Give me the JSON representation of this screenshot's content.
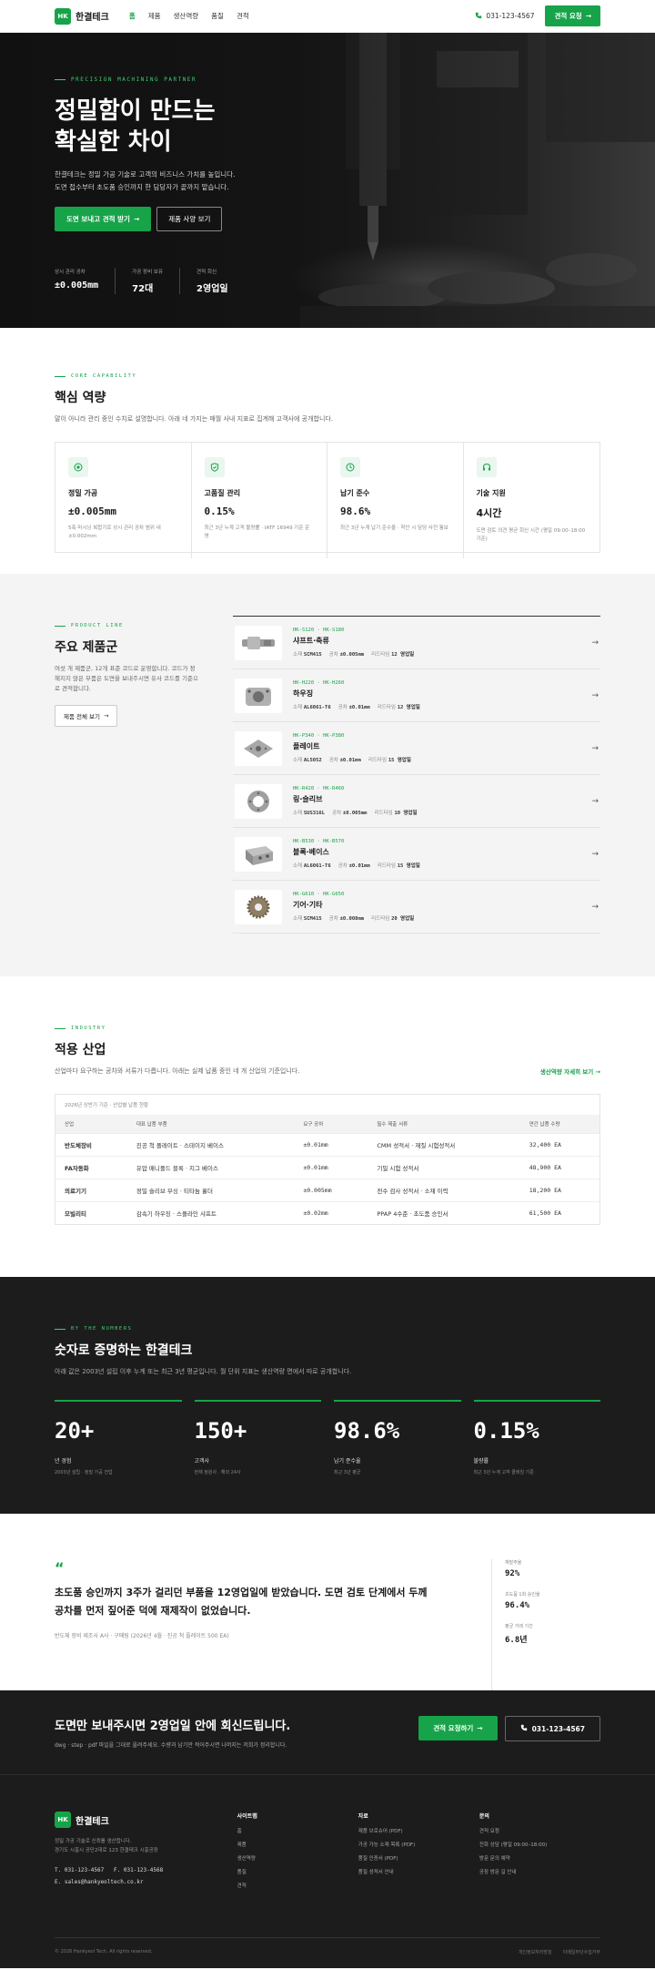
{
  "header": {
    "logo": "HK",
    "brand": "한결테크",
    "nav": [
      "홈",
      "제품",
      "생산역량",
      "품질",
      "견적"
    ],
    "phone": "031-123-4567",
    "cta": "견적 요청"
  },
  "hero": {
    "eyebrow": "PRECISION MACHINING PARTNER",
    "title_line1": "정밀함이 만드는",
    "title_line2": "확실한 차이",
    "desc_line1": "한결테크는 정밀 가공 기술로 고객의 비즈니스 가치를 높입니다.",
    "desc_line2": "도면 접수부터 초도품 승인까지 한 담당자가 끝까지 맡습니다.",
    "btn_primary": "도면 보내고 견적 받기",
    "btn_secondary": "제품 사양 보기",
    "stats": [
      {
        "label": "상시 관리 공차",
        "value": "±0.005mm"
      },
      {
        "label": "가공 장비 보유",
        "value": "72대"
      },
      {
        "label": "견적 회신",
        "value": "2영업일"
      }
    ]
  },
  "capability": {
    "eyebrow": "CORE CAPABILITY",
    "title": "핵심 역량",
    "desc": "말이 아니라 관리 중인 수치로 설명합니다. 아래 네 가지는 매월 사내 지표로 집계해 고객사에 공개합니다.",
    "cards": [
      {
        "icon": "target-icon",
        "name": "정밀 가공",
        "value": "±0.005mm",
        "desc": "5축 머시닝 복합기로 상시 관리 공차 범위 내 ±0.002mm"
      },
      {
        "icon": "shield-check-icon",
        "name": "고품질 관리",
        "value": "0.15%",
        "desc": "최근 3년 누계 고객 불량률 · IATF 16949 기준 운영"
      },
      {
        "icon": "clock-icon",
        "name": "납기 준수",
        "value": "98.6%",
        "desc": "최근 3년 누계 납기 준수율 · 착안 시 담당 사전 통보"
      },
      {
        "icon": "headset-icon",
        "name": "기술 지원",
        "value": "4시간",
        "desc": "도면 검토 의견 평균 회신 시간 (평일 09:00–18:00 기준)"
      }
    ]
  },
  "products": {
    "eyebrow": "PRODUCT LINE",
    "title": "주요 제품군",
    "desc": "여섯 개 제품군, 12개 표준 코드로 운영합니다. 코드가 정해지지 않은 부품은 도면을 보내주시면 유사 코드를 기준으로 견적합니다.",
    "button": "제품 전체 보기",
    "labels": {
      "material": "소재",
      "tolerance": "공차",
      "lead": "리드타임"
    },
    "items": [
      {
        "code": "HK-S120 · HK-S180",
        "name": "샤프트·축류",
        "material": "SCM415",
        "tolerance": "±0.005mm",
        "lead": "12 영업일",
        "shape": "shaft"
      },
      {
        "code": "HK-H220 · HK-H260",
        "name": "하우징",
        "material": "AL6061-T6",
        "tolerance": "±0.01mm",
        "lead": "12 영업일",
        "shape": "housing"
      },
      {
        "code": "HK-P340 · HK-P380",
        "name": "플레이트",
        "material": "AL5052",
        "tolerance": "±0.01mm",
        "lead": "15 영업일",
        "shape": "plate"
      },
      {
        "code": "HK-R420 · HK-R460",
        "name": "링·슬리브",
        "material": "SUS316L",
        "tolerance": "±0.005mm",
        "lead": "10 영업일",
        "shape": "ring"
      },
      {
        "code": "HK-B530 · HK-B570",
        "name": "블록·베이스",
        "material": "AL6061-T6",
        "tolerance": "±0.01mm",
        "lead": "15 영업일",
        "shape": "block"
      },
      {
        "code": "HK-G610 · HK-G650",
        "name": "기어·기타",
        "material": "SCM415",
        "tolerance": "±0.008mm",
        "lead": "20 영업일",
        "shape": "gear"
      }
    ]
  },
  "industry": {
    "eyebrow": "INDUSTRY",
    "title": "적용 산업",
    "desc": "산업마다 요구하는 공차와 서류가 다릅니다. 아래는 실제 납품 중인 네 개 산업의 기준입니다.",
    "link": "생산역량 자세히 보기",
    "caption": "2026년 상반기 기준 · 산업별 납품 현황",
    "columns": [
      "산업",
      "대표 납품 부품",
      "요구 공차",
      "필수 제출 서류",
      "연간 납품 수량"
    ],
    "rows": [
      [
        "반도체장비",
        "진공 척 플레이트 · 스테이지 베이스",
        "±0.01mm",
        "CMM 성적서 · 재질 시험성적서",
        "32,400 EA"
      ],
      [
        "FA자동화",
        "유압 매니폴드 블록 · 지그 베이스",
        "±0.01mm",
        "기밀 시험 성적서",
        "48,900 EA"
      ],
      [
        "의료기기",
        "정밀 슬리브 부싱 · 티타늄 홀더",
        "±0.005mm",
        "전수 검사 성적서 · 소재 이력",
        "18,200 EA"
      ],
      [
        "모빌리티",
        "감속기 하우징 · 스플라인 샤프트",
        "±0.02mm",
        "PPAP 4수준 · 초도품 승인서",
        "61,500 EA"
      ]
    ]
  },
  "numbers": {
    "eyebrow": "BY THE NUMBERS",
    "title": "숫자로 증명하는 한결테크",
    "desc": "아래 값은 2003년 설립 이후 누계 또는 최근 3년 평균입니다. 월 단위 지표는 생산역량 면에서 따로 공개합니다.",
    "stats": [
      {
        "value": "20+",
        "label": "년 경험",
        "sub": "2003년 설립 · 정밀 가공 전업"
      },
      {
        "value": "150+",
        "label": "고객사",
        "sub": "현재 정원사 · 해외 24사"
      },
      {
        "value": "98.6%",
        "label": "납기 준수율",
        "sub": "최근 3년 평균"
      },
      {
        "value": "0.15%",
        "label": "불량률",
        "sub": "최근 3년 누계 고객 클레임 기준"
      }
    ]
  },
  "testimonial": {
    "quote_mark": "“",
    "line1": "초도품 승인까지 3주가 걸리던 부품을 12영업일에 받았습니다. 도면 검토 단계에서 두께",
    "line2": "공차를 먼저 짚어준 덕에 재제작이 없었습니다.",
    "by": "반도체 장비 제조사 A사 · 구매팀 (2026년 4월 · 진공 척 플레이트 500 EA)",
    "side": [
      {
        "label": "재발주율",
        "value": "92%"
      },
      {
        "label": "초도품 1회 승인율",
        "value": "96.4%"
      },
      {
        "label": "평균 거래 기간",
        "value": "6.8년"
      }
    ]
  },
  "cta": {
    "title": "도면만 보내주시면 2영업일 안에 회신드립니다.",
    "desc": "dwg · step · pdf 파일을 그대로 올려주세요. 수량과 납기만 적어주시면 나머지는 저희가 정리합니다.",
    "btn_primary": "견적 요청하기",
    "btn_phone": "031-123-4567"
  },
  "footer": {
    "brand": "한결테크",
    "desc_line1": "정밀 가공 기술로 신뢰를 생산합니다.",
    "desc_line2": "경기도 시흥시 공단2대로 123 한결테크 시흥공장",
    "tel": "T.  031-123-4567",
    "fax": "F.  031-123-4568",
    "email": "E.  sales@hankyeoltech.co.kr",
    "cols": [
      {
        "title": "사이트맵",
        "links": [
          "홈",
          "제품",
          "생산역량",
          "품질",
          "견적"
        ]
      },
      {
        "title": "자료",
        "links": [
          "제품 브로슈어 (PDF)",
          "가공 가능 소재 목록 (PDF)",
          "품질 인증서 (PDF)",
          "품질 성적서 안내"
        ]
      },
      {
        "title": "문의",
        "links": [
          "견적 요청",
          "전화 상담 (평일 09:00–18:00)",
          "방문 문의 예약",
          "공장 방문 길 안내"
        ]
      }
    ],
    "copyright": "© 2026 Hankyeol Tech. All rights reserved.",
    "legal": [
      "개인정보처리방침",
      "이메일무단수집거부"
    ]
  },
  "colors": {
    "accent": "#17a34a",
    "dark": "#1c1c1c",
    "light_bg": "#f4f4f4"
  }
}
